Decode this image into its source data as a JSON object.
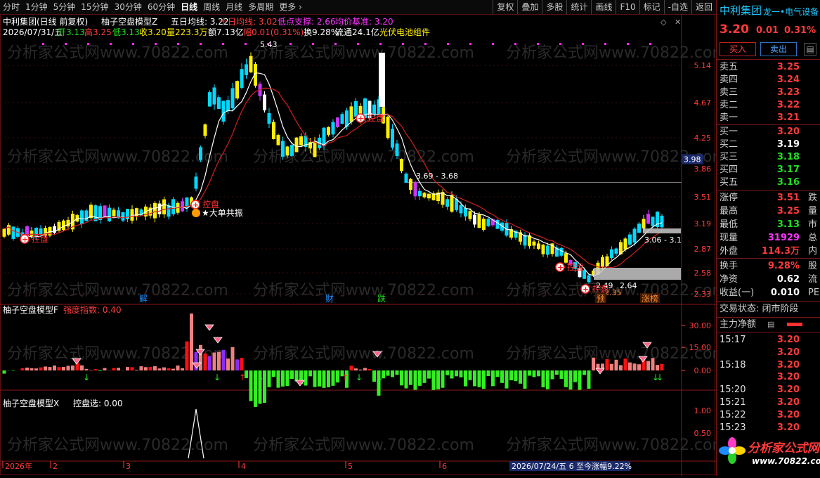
{
  "period_tabs": [
    "分时",
    "1分钟",
    "5分钟",
    "15分钟",
    "30分钟",
    "60分钟",
    "日线",
    "周线",
    "月线",
    "多周期",
    "更多 ›"
  ],
  "active_period": "日线",
  "toolbar": [
    "复权",
    "叠加",
    "多股",
    "统计",
    "画线",
    "F10",
    "标记",
    "-自选",
    "返回"
  ],
  "main": {
    "title": "中利集团(日线 前复权)",
    "indicator_name": "柚子空盘模型Z",
    "ma5_label": "五日均线: 3.22",
    "ma10_label": "十日均线: 3.02",
    "support_label": "低点支撑: 2.66",
    "base_label": "均价基准: 3.20",
    "info_date": "2026/07/31/五",
    "info_open": "开3.13",
    "info_high": "高3.25",
    "info_low": "低3.13",
    "info_close": "收3.20",
    "info_vol": "量223.3万",
    "info_amount": "额7.13亿",
    "info_change": "幅0.01(0.31%)",
    "info_turnover": "换9.28%",
    "info_float": "流通24.1亿",
    "info_concept": "光伏电池组件",
    "price_ticks": [
      "5.14",
      "4.67",
      "4.25",
      "3.86",
      "3.51",
      "3.19",
      "2.87",
      "2.58",
      "2.33"
    ],
    "current_price_tag": "3.98",
    "peak_label": "5.43",
    "range_label_1": "3.69 - 3.68",
    "range_label_2": "3.06 - 3.1",
    "low_label_1": "2.49",
    "low_label_2": "2.64",
    "low_label_3": "2.35",
    "marker_kongpan": "控盘",
    "marker_dadan": "大单共振",
    "event_labels": [
      "解",
      "财",
      "跌",
      "预",
      "涨榜"
    ]
  },
  "sub1": {
    "title": "柚子空盘模型F",
    "strength_label": "强度指数: 0.40",
    "ticks": [
      "30.00",
      "15.00",
      "0.00"
    ]
  },
  "sub2": {
    "title": "柚子空盘模型X",
    "value_label": "控盘选: 0.00",
    "ticks": [
      "1.00",
      "0.50"
    ]
  },
  "time_axis": {
    "labels": [
      "2026年",
      "2",
      "3",
      "4",
      "5",
      "6"
    ],
    "status_text": "2026/07/24/五 6 至今涨幅9.22%"
  },
  "watermark": "分析家公式网www.70822.com",
  "right_panel": {
    "stock_name": "中利集团",
    "stock_tag": "龙一•电气设备",
    "price": "3.20",
    "change": "0.01",
    "change_pct": "0.31%",
    "buy_label": "买入",
    "sell_label": "卖出",
    "asks": [
      {
        "label": "卖五",
        "price": "3.25"
      },
      {
        "label": "卖四",
        "price": "3.24"
      },
      {
        "label": "卖三",
        "price": "3.23"
      },
      {
        "label": "卖二",
        "price": "3.22"
      },
      {
        "label": "卖一",
        "price": "3.21"
      }
    ],
    "bids": [
      {
        "label": "买一",
        "price": "3.20"
      },
      {
        "label": "买二",
        "price": "3.19"
      },
      {
        "label": "买三",
        "price": "3.18"
      },
      {
        "label": "买四",
        "price": "3.17"
      },
      {
        "label": "买五",
        "price": "3.16"
      }
    ],
    "stats": [
      {
        "label": "涨停",
        "value": "3.51",
        "extra": "跌"
      },
      {
        "label": "最高",
        "value": "3.25",
        "extra": "量"
      },
      {
        "label": "最低",
        "value": "3.13",
        "extra": "市"
      },
      {
        "label": "现量",
        "value": "31929",
        "extra": "总"
      },
      {
        "label": "外盘",
        "value": "114.3万",
        "extra": "内"
      }
    ],
    "stats2": [
      {
        "label": "换手",
        "value": "9.28%",
        "extra": "股"
      },
      {
        "label": "净资",
        "value": "0.62",
        "extra": "流"
      },
      {
        "label": "收益(一)",
        "value": "0.010",
        "extra": "PE"
      }
    ],
    "trade_state": "交易状态: 闭市阶段",
    "main_flow_label": "主力净额",
    "ticks_list": [
      {
        "time": "15:17",
        "price": "3.20"
      },
      {
        "time": "",
        "price": "3.20"
      },
      {
        "time": "15:18",
        "price": "3.20"
      },
      {
        "time": "",
        "price": "3.20"
      },
      {
        "time": "15:20",
        "price": "3.20"
      },
      {
        "time": "15:21",
        "price": "3.20"
      },
      {
        "time": "15:22",
        "price": "3.20"
      },
      {
        "time": "15:23",
        "price": "3.20"
      }
    ],
    "logo_text": "分析家公式网",
    "logo_url": "www.70822.com"
  },
  "colors": {
    "up": "#ff3b3b",
    "down": "#22e022",
    "candle_up": "#ffee00",
    "candle_down": "#00d8ff",
    "ma5": "#ffffff",
    "ma10": "#d02020",
    "magenta": "#cc33ff",
    "grid": "#5a1010"
  },
  "icons": [
    "settings-diamond-icon",
    "close-icon",
    "notepad-icon"
  ]
}
